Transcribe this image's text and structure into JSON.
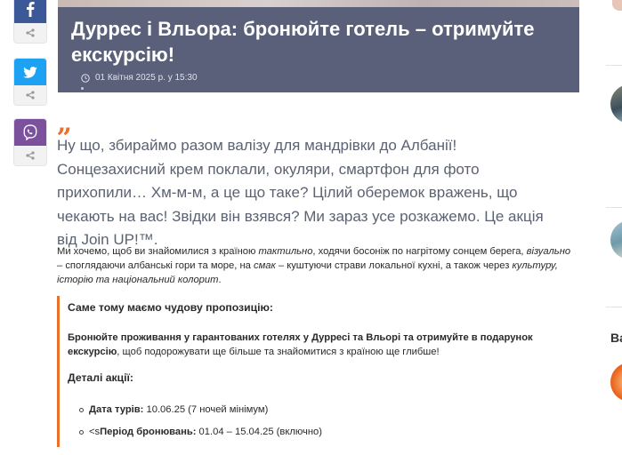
{
  "share": {
    "facebook_icon": "facebook-icon",
    "twitter_icon": "twitter-icon",
    "viber_icon": "viber-icon",
    "share_icon": "share-icon"
  },
  "article": {
    "title": "Дуррес і Вльора: бронюйте готель – отримуйте екскурсію!",
    "date": "01 Квітня 2025 р. у 15:30",
    "quote_mark": "„",
    "lead": "Ну що, збираймо разом валізу для мандрівки до Албанії! Сонцезахисний крем поклали, окуляри, смартфон для фото прихопили… Хм-м-м, а це що таке? Цілий оберемок  вражень, що чекають на вас! Звідки він взявся? Ми зараз усе розкажемо. Це акція від Join UP!™.",
    "paragraph": {
      "p1": "Ми хочемо, щоб ви знайомилися з країною ",
      "i1": "тактильно",
      "p2": ", ходячи босоніж по нагрітому сонцем берега, ",
      "i2": "візуально",
      "p3": " – споглядаючи албанські гори та море, на ",
      "i3": "смак",
      "p4": " – куштуючи страви локальної кухні, а також через ",
      "i4": "культуру, історію та національний колорит",
      "p5": "."
    },
    "callout": {
      "heading": "Саме тому маємо чудову пропозицію:",
      "offer_bold": "Бронюйте проживання у гарантованих готелях у Дурресі та Вльорі та отримуйте в подарунок екскурсію",
      "offer_rest": ", щоб подорожувати ще більше та знайомитися з країною ще глибше!",
      "details_heading": "Деталі акції:",
      "items": [
        {
          "label": "Дата турів:",
          "value": " 10.06.25 (7 ночей мінімум)"
        },
        {
          "prefix": "<s",
          "label": "Період бронювань:",
          "value": " 01.04 – 15.04.25 (включно)"
        }
      ]
    }
  },
  "sidebar": {
    "heading_fragment": "Ва"
  }
}
